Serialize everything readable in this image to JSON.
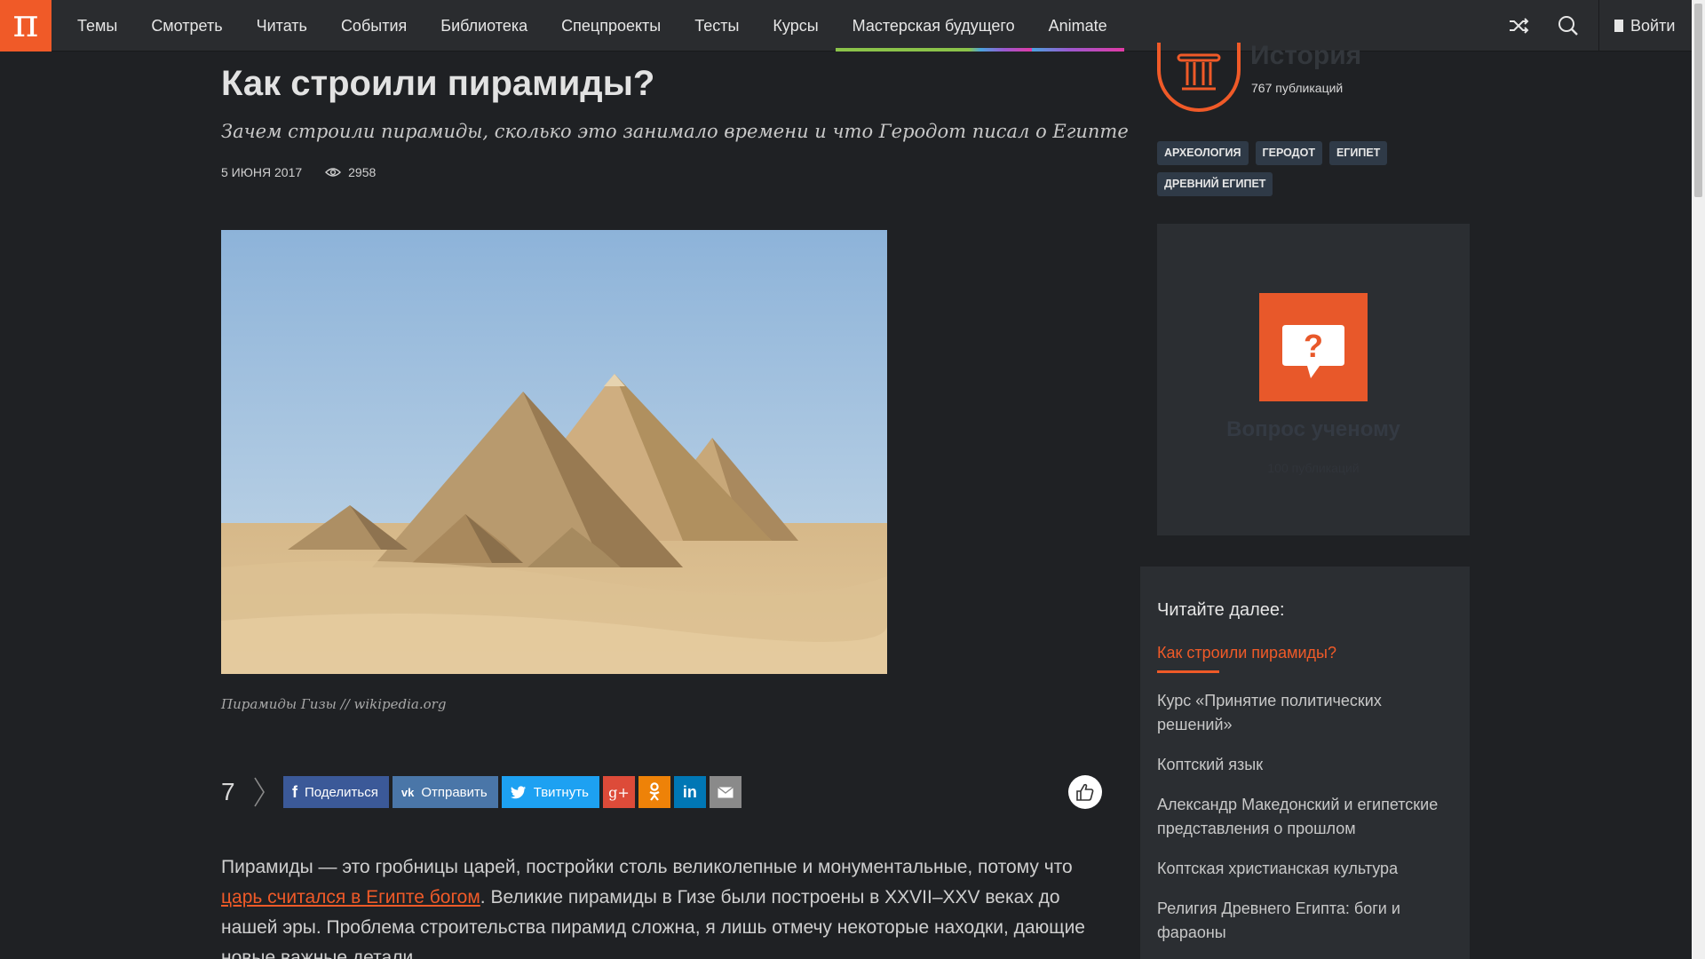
{
  "header": {
    "logo": "π",
    "nav": [
      "Темы",
      "Смотреть",
      "Читать",
      "События",
      "Библиотека",
      "Спецпроекты",
      "Тесты",
      "Курсы",
      "Мастерская будущего",
      "Animate"
    ],
    "login_label": "Войти"
  },
  "article": {
    "title": "Как строили пирамиды?",
    "subtitle": "Зачем строили пирамиды, сколько это занимало времени и что Геродот писал о Египте",
    "date": "5 ИЮНЯ 2017",
    "views": "2958",
    "caption": "Пирамиды Гизы // wikipedia.org",
    "body_before_link": "Пирамиды — это гробницы царей, постройки столь великолепные и монументальные, потому что ",
    "body_link": "царь считался в Египте богом",
    "body_after_link": ". Великие пирамиды в Гизе были построены в XXVII–XXV веках до нашей эры. Проблема строительства пирамид сложна, я лишь отмечу некоторые находки, дающие новые важные детали."
  },
  "share": {
    "count": "7",
    "facebook": "Поделиться",
    "vk": "Отправить",
    "twitter": "Твитнуть",
    "colors": {
      "facebook": "#3b5998",
      "vk": "#4a76a8",
      "twitter": "#1da1f2",
      "gplus": "#dd4b39",
      "ok": "#ee8208",
      "linkedin": "#0077b5",
      "email": "#8a8a8a"
    }
  },
  "sidebar": {
    "rubric": "История",
    "rubric_count": "767 публикаций",
    "tags": [
      "АРХЕОЛОГИЯ",
      "ГЕРОДОТ",
      "ЕГИПЕТ",
      "ДРЕВНИЙ ЕГИПЕТ"
    ],
    "ask_title": "Вопрос ученому",
    "ask_sub": "100 публикаций",
    "read_next_title": "Читайте далее:",
    "read_next": [
      "Как строили пирамиды?",
      "Курс «Принятие политических решений»",
      "Коптский язык",
      "Александр Македонский и египетские представления о прошлом",
      "Коптская христианская культура",
      "Религия Древнего Египта: боги и фараоны"
    ]
  }
}
